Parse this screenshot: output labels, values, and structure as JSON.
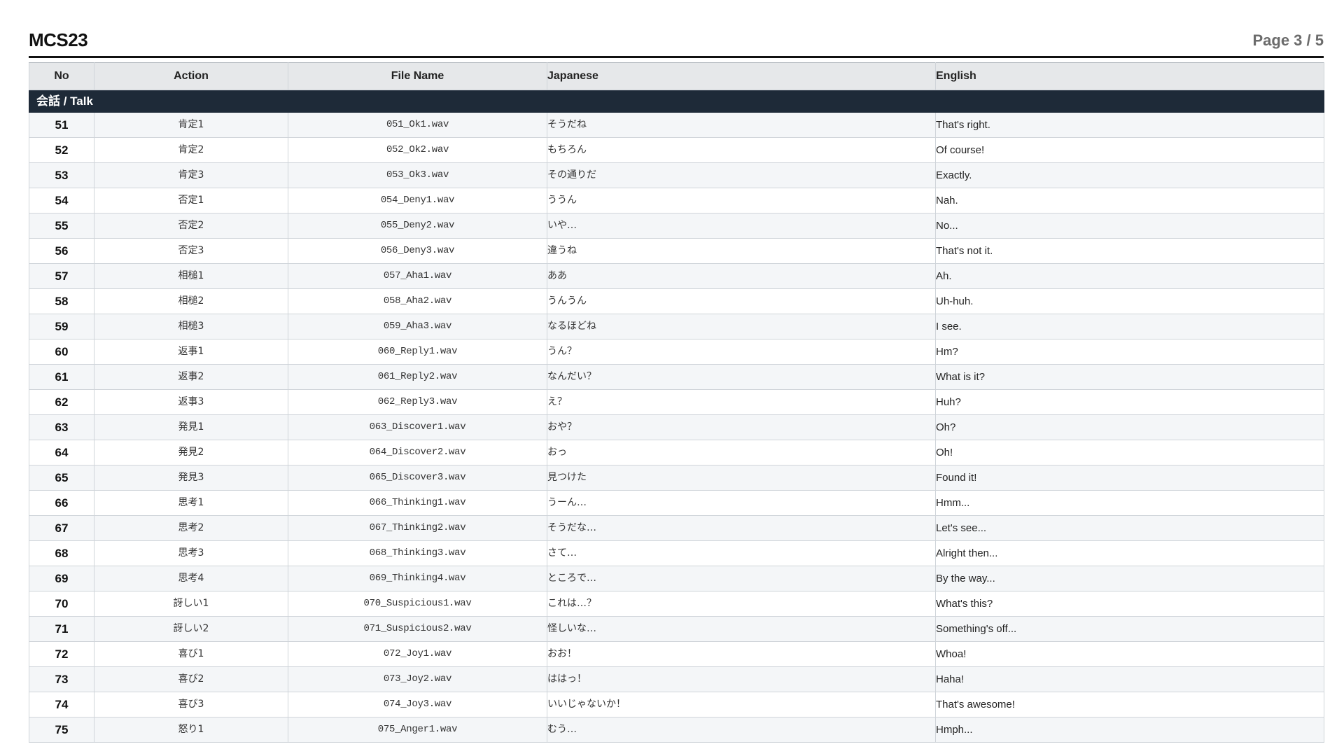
{
  "document": {
    "title": "MCS23",
    "page_indicator": "Page 3 / 5"
  },
  "table": {
    "columns": {
      "no": "No",
      "action": "Action",
      "file_name": "File Name",
      "japanese": "Japanese",
      "english": "English"
    },
    "section": "会話 / Talk",
    "rows": [
      {
        "no": "51",
        "action": "肯定1",
        "file": "051_Ok1.wav",
        "jp": "そうだね",
        "en": "That's right."
      },
      {
        "no": "52",
        "action": "肯定2",
        "file": "052_Ok2.wav",
        "jp": "もちろん",
        "en": "Of course!"
      },
      {
        "no": "53",
        "action": "肯定3",
        "file": "053_Ok3.wav",
        "jp": "その通りだ",
        "en": "Exactly."
      },
      {
        "no": "54",
        "action": "否定1",
        "file": "054_Deny1.wav",
        "jp": "ううん",
        "en": "Nah."
      },
      {
        "no": "55",
        "action": "否定2",
        "file": "055_Deny2.wav",
        "jp": "いや…",
        "en": "No..."
      },
      {
        "no": "56",
        "action": "否定3",
        "file": "056_Deny3.wav",
        "jp": "違うね",
        "en": "That's not it."
      },
      {
        "no": "57",
        "action": "相槌1",
        "file": "057_Aha1.wav",
        "jp": "ああ",
        "en": "Ah."
      },
      {
        "no": "58",
        "action": "相槌2",
        "file": "058_Aha2.wav",
        "jp": "うんうん",
        "en": "Uh-huh."
      },
      {
        "no": "59",
        "action": "相槌3",
        "file": "059_Aha3.wav",
        "jp": "なるほどね",
        "en": "I see."
      },
      {
        "no": "60",
        "action": "返事1",
        "file": "060_Reply1.wav",
        "jp": "うん？",
        "en": "Hm?"
      },
      {
        "no": "61",
        "action": "返事2",
        "file": "061_Reply2.wav",
        "jp": "なんだい？",
        "en": "What is it?"
      },
      {
        "no": "62",
        "action": "返事3",
        "file": "062_Reply3.wav",
        "jp": "え？",
        "en": "Huh?"
      },
      {
        "no": "63",
        "action": "発見1",
        "file": "063_Discover1.wav",
        "jp": "おや？",
        "en": "Oh?"
      },
      {
        "no": "64",
        "action": "発見2",
        "file": "064_Discover2.wav",
        "jp": "おっ",
        "en": "Oh!"
      },
      {
        "no": "65",
        "action": "発見3",
        "file": "065_Discover3.wav",
        "jp": "見つけた",
        "en": "Found it!"
      },
      {
        "no": "66",
        "action": "思考1",
        "file": "066_Thinking1.wav",
        "jp": "うーん…",
        "en": "Hmm..."
      },
      {
        "no": "67",
        "action": "思考2",
        "file": "067_Thinking2.wav",
        "jp": "そうだな…",
        "en": "Let's see..."
      },
      {
        "no": "68",
        "action": "思考3",
        "file": "068_Thinking3.wav",
        "jp": "さて…",
        "en": "Alright then..."
      },
      {
        "no": "69",
        "action": "思考4",
        "file": "069_Thinking4.wav",
        "jp": "ところで…",
        "en": "By the way..."
      },
      {
        "no": "70",
        "action": "訝しい1",
        "file": "070_Suspicious1.wav",
        "jp": "これは…？",
        "en": "What's this?"
      },
      {
        "no": "71",
        "action": "訝しい2",
        "file": "071_Suspicious2.wav",
        "jp": "怪しいな…",
        "en": "Something's off..."
      },
      {
        "no": "72",
        "action": "喜び1",
        "file": "072_Joy1.wav",
        "jp": "おお！",
        "en": "Whoa!"
      },
      {
        "no": "73",
        "action": "喜び2",
        "file": "073_Joy2.wav",
        "jp": "ははっ！",
        "en": "Haha!"
      },
      {
        "no": "74",
        "action": "喜び3",
        "file": "074_Joy3.wav",
        "jp": "いいじゃないか！",
        "en": "That's awesome!"
      },
      {
        "no": "75",
        "action": "怒り1",
        "file": "075_Anger1.wav",
        "jp": "むう…",
        "en": "Hmph..."
      }
    ]
  },
  "colors": {
    "section_bg": "#1e2a38",
    "header_bg": "#e6e8ea",
    "stripe_bg": "#f4f6f8"
  }
}
